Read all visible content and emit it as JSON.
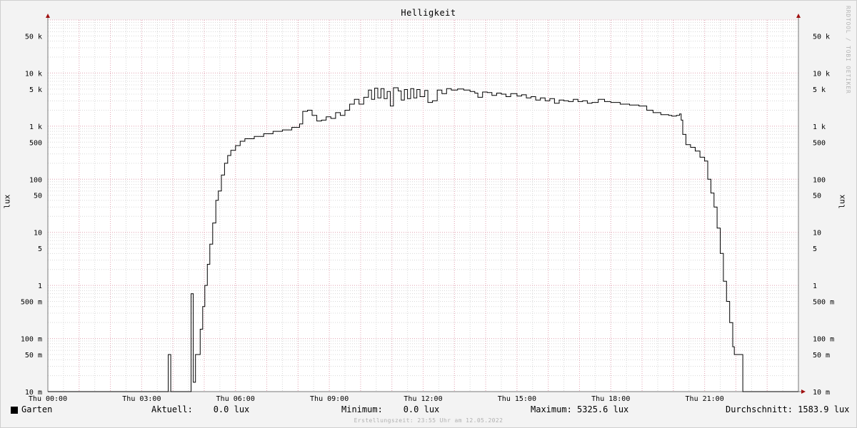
{
  "chart_data": {
    "type": "line",
    "title": "Helligkeit",
    "ylabel": "lux",
    "xlabel": "",
    "yscale": "log",
    "ylim": [
      0.01,
      100000
    ],
    "xlim": [
      0,
      24
    ],
    "y_ticks": [
      {
        "value": 0.01,
        "label": "10 m"
      },
      {
        "value": 0.05,
        "label": "50 m"
      },
      {
        "value": 0.1,
        "label": "100 m"
      },
      {
        "value": 0.5,
        "label": "500 m"
      },
      {
        "value": 1,
        "label": "1"
      },
      {
        "value": 5,
        "label": "5"
      },
      {
        "value": 10,
        "label": "10"
      },
      {
        "value": 50,
        "label": "50"
      },
      {
        "value": 100,
        "label": "100"
      },
      {
        "value": 500,
        "label": "500"
      },
      {
        "value": 1000,
        "label": "1 k"
      },
      {
        "value": 5000,
        "label": "5 k"
      },
      {
        "value": 10000,
        "label": "10 k"
      },
      {
        "value": 50000,
        "label": "50 k"
      }
    ],
    "x_ticks": [
      {
        "value": 0,
        "label": "Thu 00:00"
      },
      {
        "value": 3,
        "label": "Thu 03:00"
      },
      {
        "value": 6,
        "label": "Thu 06:00"
      },
      {
        "value": 9,
        "label": "Thu 09:00"
      },
      {
        "value": 12,
        "label": "Thu 12:00"
      },
      {
        "value": 15,
        "label": "Thu 15:00"
      },
      {
        "value": 18,
        "label": "Thu 18:00"
      },
      {
        "value": 21,
        "label": "Thu 21:00"
      }
    ],
    "grid": true,
    "series": [
      {
        "name": "Garten",
        "color": "#000000",
        "points": [
          [
            0.0,
            0.0
          ],
          [
            3.83,
            0.0
          ],
          [
            3.85,
            0.05
          ],
          [
            3.92,
            0.05
          ],
          [
            3.93,
            0.0
          ],
          [
            4.57,
            0.0
          ],
          [
            4.58,
            0.7
          ],
          [
            4.63,
            0.7
          ],
          [
            4.65,
            0.015
          ],
          [
            4.7,
            0.015
          ],
          [
            4.72,
            0.05
          ],
          [
            4.85,
            0.05
          ],
          [
            4.87,
            0.15
          ],
          [
            4.95,
            0.4
          ],
          [
            5.02,
            1.0
          ],
          [
            5.1,
            2.5
          ],
          [
            5.18,
            6
          ],
          [
            5.27,
            15
          ],
          [
            5.37,
            40
          ],
          [
            5.45,
            60
          ],
          [
            5.55,
            120
          ],
          [
            5.65,
            200
          ],
          [
            5.75,
            280
          ],
          [
            5.85,
            350
          ],
          [
            6.0,
            430
          ],
          [
            6.15,
            520
          ],
          [
            6.3,
            580
          ],
          [
            6.6,
            640
          ],
          [
            6.9,
            720
          ],
          [
            7.2,
            800
          ],
          [
            7.5,
            850
          ],
          [
            7.8,
            950
          ],
          [
            8.05,
            1100
          ],
          [
            8.15,
            1900
          ],
          [
            8.3,
            2000
          ],
          [
            8.45,
            1600
          ],
          [
            8.6,
            1250
          ],
          [
            8.75,
            1300
          ],
          [
            8.9,
            1500
          ],
          [
            9.05,
            1400
          ],
          [
            9.2,
            1800
          ],
          [
            9.35,
            1600
          ],
          [
            9.5,
            2000
          ],
          [
            9.65,
            2600
          ],
          [
            9.8,
            3200
          ],
          [
            9.95,
            2600
          ],
          [
            10.1,
            3500
          ],
          [
            10.25,
            4800
          ],
          [
            10.35,
            3200
          ],
          [
            10.45,
            5200
          ],
          [
            10.55,
            3400
          ],
          [
            10.65,
            5100
          ],
          [
            10.75,
            3300
          ],
          [
            10.85,
            4500
          ],
          [
            10.95,
            2400
          ],
          [
            11.05,
            5300
          ],
          [
            11.2,
            4600
          ],
          [
            11.3,
            3100
          ],
          [
            11.4,
            4900
          ],
          [
            11.5,
            3300
          ],
          [
            11.6,
            5100
          ],
          [
            11.7,
            3400
          ],
          [
            11.8,
            4900
          ],
          [
            11.9,
            3600
          ],
          [
            12.05,
            4700
          ],
          [
            12.15,
            2800
          ],
          [
            12.3,
            3000
          ],
          [
            12.45,
            4800
          ],
          [
            12.6,
            4100
          ],
          [
            12.75,
            5100
          ],
          [
            12.9,
            4800
          ],
          [
            13.1,
            5000
          ],
          [
            13.3,
            4800
          ],
          [
            13.5,
            4500
          ],
          [
            13.65,
            4200
          ],
          [
            13.75,
            3500
          ],
          [
            13.9,
            4400
          ],
          [
            14.05,
            4300
          ],
          [
            14.2,
            3800
          ],
          [
            14.35,
            4200
          ],
          [
            14.5,
            4000
          ],
          [
            14.65,
            3600
          ],
          [
            14.8,
            4100
          ],
          [
            15.0,
            3700
          ],
          [
            15.15,
            3900
          ],
          [
            15.3,
            3400
          ],
          [
            15.45,
            3600
          ],
          [
            15.6,
            3100
          ],
          [
            15.75,
            3400
          ],
          [
            15.9,
            3000
          ],
          [
            16.05,
            3300
          ],
          [
            16.2,
            2700
          ],
          [
            16.35,
            3100
          ],
          [
            16.5,
            3000
          ],
          [
            16.65,
            2900
          ],
          [
            16.8,
            3200
          ],
          [
            16.95,
            2900
          ],
          [
            17.1,
            3000
          ],
          [
            17.25,
            2700
          ],
          [
            17.4,
            2800
          ],
          [
            17.6,
            3200
          ],
          [
            17.8,
            2900
          ],
          [
            18.0,
            2800
          ],
          [
            18.3,
            2600
          ],
          [
            18.6,
            2500
          ],
          [
            18.9,
            2400
          ],
          [
            19.15,
            2000
          ],
          [
            19.35,
            1800
          ],
          [
            19.6,
            1650
          ],
          [
            19.85,
            1600
          ],
          [
            19.95,
            1550
          ],
          [
            20.1,
            1600
          ],
          [
            20.2,
            1700
          ],
          [
            20.25,
            1300
          ],
          [
            20.3,
            700
          ],
          [
            20.4,
            450
          ],
          [
            20.55,
            400
          ],
          [
            20.7,
            340
          ],
          [
            20.85,
            260
          ],
          [
            21.0,
            220
          ],
          [
            21.1,
            100
          ],
          [
            21.2,
            55
          ],
          [
            21.3,
            30
          ],
          [
            21.4,
            12
          ],
          [
            21.5,
            4
          ],
          [
            21.6,
            1.2
          ],
          [
            21.7,
            0.5
          ],
          [
            21.8,
            0.2
          ],
          [
            21.9,
            0.07
          ],
          [
            21.95,
            0.05
          ],
          [
            22.2,
            0.05
          ],
          [
            22.22,
            0.0
          ],
          [
            24.0,
            0.0
          ]
        ]
      }
    ],
    "legend": {
      "name": "Garten",
      "stats": [
        {
          "label": "Aktuell:",
          "value": "0.0 lux"
        },
        {
          "label": "Minimum:",
          "value": "0.0 lux"
        },
        {
          "label": "Maximum:",
          "value": "5325.6 lux"
        },
        {
          "label": "Durchschnitt:",
          "value": "1583.9 lux"
        }
      ]
    }
  },
  "labels": {
    "title": "Helligkeit",
    "ylabel": "lux",
    "watermark": "RRDTOOL / TOBI OETIKER",
    "footer": "Erstellungszeit: 23:55 Uhr am 12.05.2022",
    "legend_name": "Garten",
    "stat_current": "Aktuell:    0.0 lux",
    "stat_min": "Minimum:    0.0 lux",
    "stat_max": "Maximum: 5325.6 lux",
    "stat_avg": "Durchschnitt: 1583.9 lux"
  },
  "colors": {
    "background": "#f3f3f3",
    "plot": "#ffffff",
    "minor_grid": "#d8d8d8",
    "major_grid": "#e8a8b8",
    "axis": "#7a7a7a",
    "arrow": "#a01010",
    "line": "#000000"
  }
}
